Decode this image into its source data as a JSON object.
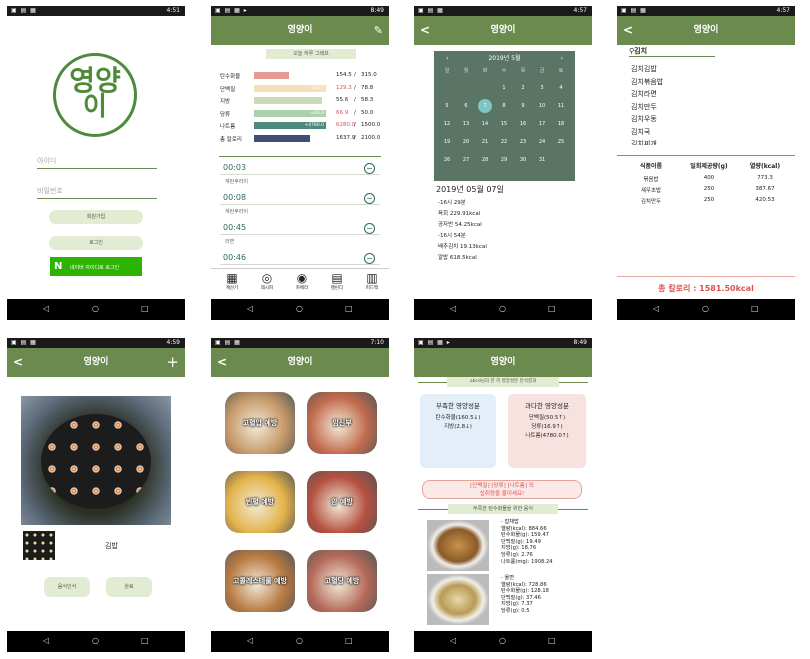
{
  "p1": {
    "time": "4:51",
    "logo_line1": "영양",
    "logo_line2": "이",
    "id_placeholder": "아이디",
    "pw_placeholder": "비밀번호",
    "signup": "회원가입",
    "login": "로그인",
    "naver_n": "N",
    "naver": "네이버 아이디로 로그인"
  },
  "p2": {
    "time": "8:49",
    "title": "영양이",
    "section": "오늘 하루 그래프",
    "rows": [
      {
        "label": "탄수화물",
        "overlay": "",
        "value": "154.5",
        "max": "315.0",
        "color": "#e59a93",
        "frac": 0.49,
        "over": false
      },
      {
        "label": "단백질",
        "overlay": "+50.7",
        "value": "129.3",
        "max": "78.8",
        "color": "#f7dfb8",
        "frac": 1.0,
        "over": true
      },
      {
        "label": "지방",
        "overlay": "",
        "value": "55.6",
        "max": "58.3",
        "color": "#c8dbb4",
        "frac": 0.95,
        "over": false
      },
      {
        "label": "당류",
        "overlay": "+16.9",
        "value": "66.9",
        "max": "50.0",
        "color": "#abd1ad",
        "frac": 1.0,
        "over": true
      },
      {
        "label": "나트륨",
        "overlay": "+4780.0",
        "value": "6280.0",
        "max": "1500.0",
        "color": "#4f887c",
        "frac": 1.0,
        "over": true
      },
      {
        "label": "총 칼로리",
        "overlay": "",
        "value": "1637.9",
        "max": "2100.0",
        "color": "#3e4f77",
        "frac": 0.78,
        "over": false
      }
    ],
    "timeline": [
      {
        "time": "00:03",
        "food": "계란후라이"
      },
      {
        "time": "00:08",
        "food": "계란후라이"
      },
      {
        "time": "00:45",
        "food": "라면"
      },
      {
        "time": "00:46",
        "food": ""
      }
    ],
    "tabs": [
      "계산기",
      "레시피",
      "카메라",
      "캘린더",
      "피드백"
    ]
  },
  "p3": {
    "time": "4:57",
    "title": "영양이",
    "month": "2019년 5월",
    "weekdays": [
      "일",
      "월",
      "화",
      "수",
      "목",
      "금",
      "토"
    ],
    "days": [
      [
        "",
        "",
        "",
        "1",
        "2",
        "3",
        "4"
      ],
      [
        "5",
        "6",
        "7",
        "8",
        "9",
        "10",
        "11"
      ],
      [
        "12",
        "13",
        "14",
        "15",
        "16",
        "17",
        "18"
      ],
      [
        "19",
        "20",
        "21",
        "22",
        "23",
        "24",
        "25"
      ],
      [
        "26",
        "27",
        "28",
        "29",
        "30",
        "31",
        ""
      ]
    ],
    "selected": "7",
    "date": "2019년 05월 07일",
    "entries": [
      "-16시 29분",
      "육회  229.91kcal",
      "공자반  54.25kcal",
      "-16시 54분",
      "배추김치  19.13kcal",
      "알밥  618.5kcal"
    ]
  },
  "p4": {
    "time": "4:57",
    "title": "영양이",
    "search": "김치",
    "results": [
      "김치김밥",
      "김치볶음밥",
      "김치라면",
      "김치만두",
      "김치우동",
      "김치국",
      "김치찌개"
    ],
    "headers": [
      "식품이름",
      "일회제공량(g)",
      "열량(kcal)"
    ],
    "rows": [
      [
        "볶음밥",
        "400",
        "773.3"
      ],
      [
        "새우초밥",
        "250",
        "387.67"
      ],
      [
        "김치만두",
        "250",
        "420.53"
      ]
    ],
    "total": "총 칼로리 : 1581.50kcal"
  },
  "p5": {
    "time": "4:59",
    "title": "영양이",
    "food": "김밥",
    "recognize": "음식인식",
    "done": "완료"
  },
  "p6": {
    "time": "7:10",
    "title": "영양이",
    "cards": [
      {
        "label": "고혈압 예방",
        "color": "#c79a6a"
      },
      {
        "label": "임신부",
        "color": "#c26b4e"
      },
      {
        "label": "빈혈 예방",
        "color": "#e4b34a"
      },
      {
        "label": "암 예방",
        "color": "#b55040"
      },
      {
        "label": "고콜레스테롤 예방",
        "color": "#b87a42"
      },
      {
        "label": "고혈당 예방",
        "color": "#b56a5a"
      }
    ]
  },
  "p7": {
    "time": "8:49",
    "title": "영양이",
    "banner": "abcd님의 한 끼 영양성분 분석결과",
    "lack_title": "부족한 영양성분",
    "lack_items": [
      "탄수화물(160.5↓)",
      "지방(2.8↓)"
    ],
    "over_title": "과다한 영양성분",
    "over_items": [
      "단백질(50.5↑)",
      "당류(16.9↑)",
      "나트륨(4780.0↑)"
    ],
    "warn_line1": "[단백질] [당류] [나트륨] 의",
    "warn_line2": "섭취량을 줄이세요!",
    "food_title": "부족한 탄수화물을 위한 음식",
    "food1": [
      "- 잡채밥",
      "열량(kcal): 884.66",
      "탄수화물(g): 159.47",
      "단백질(g): 19.49",
      "지방(g): 18.76",
      "당류(g): 2.76",
      "나트륨(mg): 1908.24"
    ],
    "food2": [
      "- 울면",
      "열량(kcal): 728.86",
      "탄수화물(g): 128.18",
      "단백질(g): 37.46",
      "지방(g): 7.37",
      "당류(g): 0.5"
    ]
  }
}
